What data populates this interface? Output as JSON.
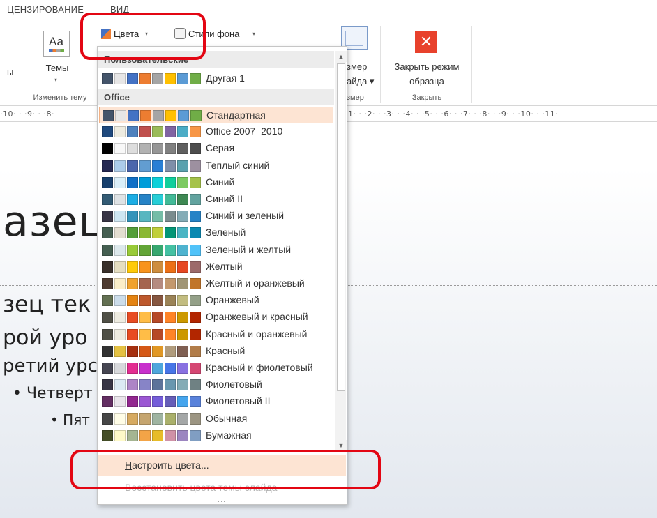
{
  "ribbon_tabs": {
    "licensing": "ЦЕНЗИРОВАНИЕ",
    "view": "ВИД"
  },
  "ribbon": {
    "left_fragment": "ы",
    "themes_label": "Темы",
    "themes_icon_text": "Аа",
    "edit_theme_group": "Изменить тему",
    "colors_label": "Цвета",
    "bg_styles_label": "Стили фона",
    "caret": "▾",
    "slide_size_line1": "змер",
    "slide_size_line2": "айда ▾",
    "size_group": "змер",
    "close_master_line1": "Закрыть режим",
    "close_master_line2": "образца",
    "close_group": "Закрыть"
  },
  "ruler": {
    "left": "·10· · ·9· · ·8·",
    "right": "1· · ·2· · ·3· · ·4· · ·5· · ·6· · ·7· · ·8· · ·9· · ·10· · ·11·"
  },
  "slide": {
    "title": "азец",
    "lines": [
      "зец тек",
      "рой уро",
      "ретий урс",
      "• Четверт",
      "• Пят"
    ]
  },
  "dropdown": {
    "custom_header": "Пользовательские",
    "office_header": "Office",
    "custom_items": [
      {
        "name": "Другая 1",
        "colors": [
          "#44546a",
          "#e7e6e6",
          "#4472c4",
          "#ed7d31",
          "#a5a5a5",
          "#ffc000",
          "#5b9bd5",
          "#70ad47"
        ]
      }
    ],
    "office_items": [
      {
        "name": "Стандартная",
        "colors": [
          "#44546a",
          "#e7e6e6",
          "#4472c4",
          "#ed7d31",
          "#a5a5a5",
          "#ffc000",
          "#5b9bd5",
          "#70ad47"
        ]
      },
      {
        "name": "Office 2007–2010",
        "colors": [
          "#1f497d",
          "#eeece1",
          "#4f81bd",
          "#c0504d",
          "#9bbb59",
          "#8064a2",
          "#4bacc6",
          "#f79646"
        ]
      },
      {
        "name": "Серая",
        "colors": [
          "#000000",
          "#f8f8f8",
          "#dddddd",
          "#b2b2b2",
          "#969696",
          "#808080",
          "#5f5f5f",
          "#4d4d4d"
        ]
      },
      {
        "name": "Теплый синий",
        "colors": [
          "#242852",
          "#acccea",
          "#4a66ac",
          "#629dd1",
          "#297fd5",
          "#7f8fa9",
          "#5aa2ae",
          "#9d90a0"
        ]
      },
      {
        "name": "Синий",
        "colors": [
          "#17406d",
          "#dbeff9",
          "#0f6fc6",
          "#009dd9",
          "#0bd0d9",
          "#10cf9b",
          "#7cca62",
          "#a5c249"
        ]
      },
      {
        "name": "Синий II",
        "colors": [
          "#335b74",
          "#dfe3e5",
          "#1cade4",
          "#2683c6",
          "#27ced7",
          "#42ba97",
          "#3e8853",
          "#62a39f"
        ]
      },
      {
        "name": "Синий и зеленый",
        "colors": [
          "#373545",
          "#cee6f2",
          "#3494ba",
          "#58b6c0",
          "#75bda7",
          "#7a8c8e",
          "#84acb6",
          "#2683c6"
        ]
      },
      {
        "name": "Зеленый",
        "colors": [
          "#455f51",
          "#e3ded1",
          "#549e39",
          "#8ab833",
          "#c0cf3a",
          "#029676",
          "#4ab5c4",
          "#0989b1"
        ]
      },
      {
        "name": "Зеленый и желтый",
        "colors": [
          "#455f51",
          "#dde9ec",
          "#99cb38",
          "#63a537",
          "#37a76f",
          "#44c1a3",
          "#4eb3cf",
          "#51c3f9"
        ]
      },
      {
        "name": "Желтый",
        "colors": [
          "#39302a",
          "#e5dec1",
          "#ffca08",
          "#f8931d",
          "#ce8d3e",
          "#ec7016",
          "#e64823",
          "#9c6a6a"
        ]
      },
      {
        "name": "Желтый и оранжевый",
        "colors": [
          "#4e3b30",
          "#fbeec9",
          "#f0a22e",
          "#a5644e",
          "#b58b80",
          "#c3986d",
          "#a19574",
          "#c17529"
        ]
      },
      {
        "name": "Оранжевый",
        "colors": [
          "#637052",
          "#ccddea",
          "#e48312",
          "#bd582c",
          "#865640",
          "#9b8357",
          "#c2bc80",
          "#94a088"
        ]
      },
      {
        "name": "Оранжевый и красный",
        "colors": [
          "#505046",
          "#eeece1",
          "#e84c22",
          "#ffbd47",
          "#b64926",
          "#ff8427",
          "#cc9900",
          "#b22600"
        ]
      },
      {
        "name": "Красный и оранжевый",
        "colors": [
          "#505046",
          "#eeece1",
          "#e84c22",
          "#ffbd47",
          "#b64926",
          "#ff8427",
          "#cc9900",
          "#b22600"
        ]
      },
      {
        "name": "Красный",
        "colors": [
          "#323232",
          "#e5c243",
          "#a5300f",
          "#d55816",
          "#e19825",
          "#b19c7d",
          "#7f5f52",
          "#b27d49"
        ]
      },
      {
        "name": "Красный и фиолетовый",
        "colors": [
          "#454551",
          "#d8d9dc",
          "#e32d91",
          "#c830cc",
          "#4ea6dc",
          "#4775e7",
          "#8971e1",
          "#d54773"
        ]
      },
      {
        "name": "Фиолетовый",
        "colors": [
          "#373545",
          "#dceaf4",
          "#ad84c6",
          "#8784c7",
          "#5d739a",
          "#6997af",
          "#84acb6",
          "#6f8183"
        ]
      },
      {
        "name": "Фиолетовый II",
        "colors": [
          "#632e62",
          "#eae5eb",
          "#92278f",
          "#9b57d3",
          "#755dd9",
          "#665eb8",
          "#45a5ed",
          "#5982db"
        ]
      },
      {
        "name": "Обычная",
        "colors": [
          "#464646",
          "#fffde7",
          "#d6aa61",
          "#c5a56f",
          "#9fb4a1",
          "#aab06b",
          "#a4a7a7",
          "#9c9582"
        ]
      },
      {
        "name": "Бумажная",
        "colors": [
          "#444d26",
          "#fefac9",
          "#a5b592",
          "#f3a447",
          "#e7bc29",
          "#d092a7",
          "#9c85c0",
          "#809ec2"
        ]
      }
    ],
    "customize_prefix": "Н",
    "customize_rest": "астроить цвета...",
    "restore_label": "Восстановить цвета темы слайда",
    "grip": "····"
  }
}
